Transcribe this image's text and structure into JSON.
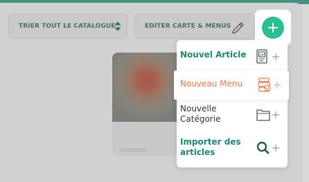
{
  "toolbar": {
    "sort_label": "TRIER TOUT LE CATALOGUE",
    "edit_label": "EDITER CARTE & MENUS"
  },
  "add_menu": {
    "items": [
      {
        "label": "Nouvel Article",
        "icon": "article-image-icon",
        "color": "#1b8a72"
      },
      {
        "label": "Nouveau Menu",
        "icon": "menu-stack-icon",
        "color": "#f07545"
      },
      {
        "label": "Nouvelle\nCatégorie",
        "icon": "folder-icon",
        "color": "#333333"
      },
      {
        "label": "Importer des\narticles",
        "icon": "search-icon",
        "color": "#1b8a72"
      }
    ]
  },
  "colors": {
    "accent": "#2bbf96",
    "brand_dark": "#2f9e86",
    "highlight": "#f07545"
  }
}
